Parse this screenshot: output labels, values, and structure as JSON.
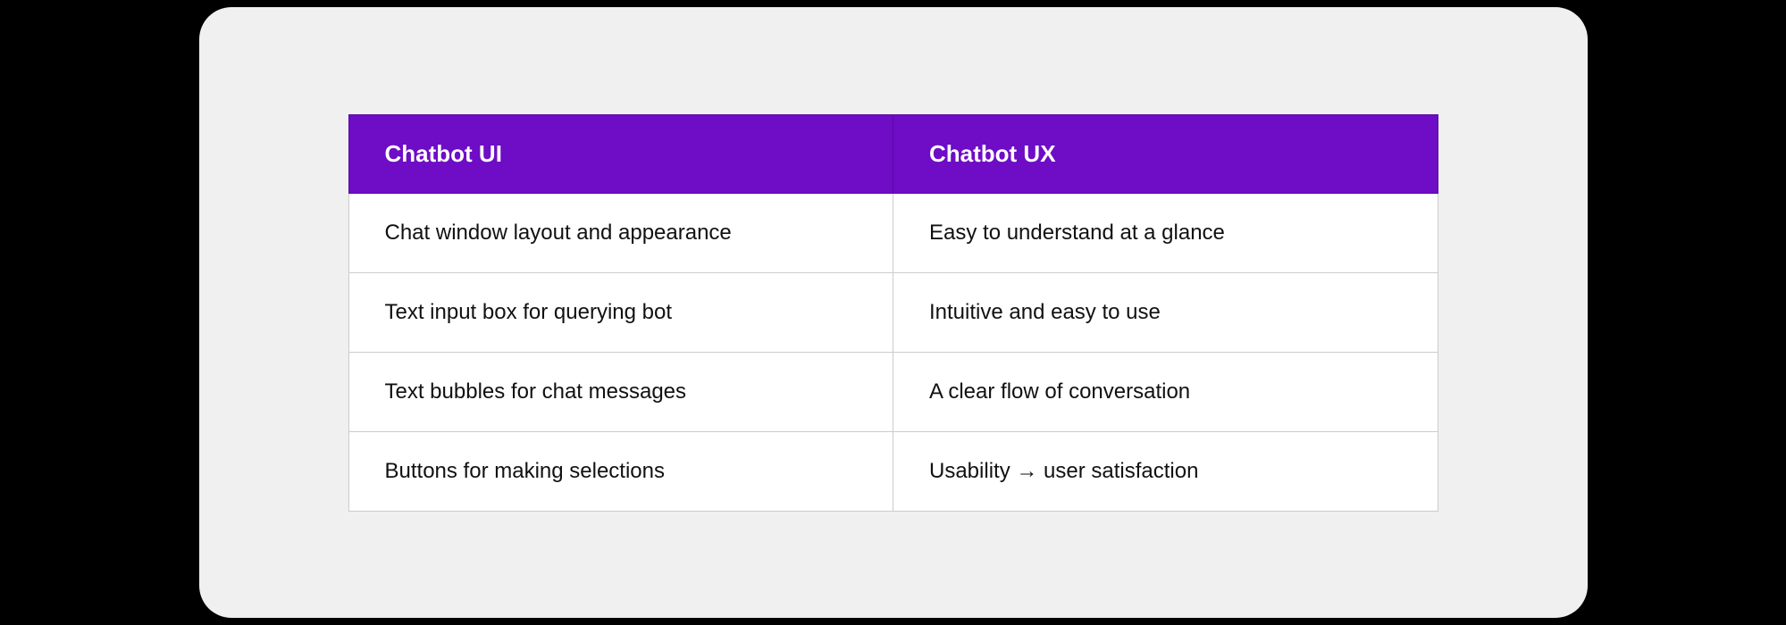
{
  "table": {
    "headers": [
      "Chatbot UI",
      "Chatbot UX"
    ],
    "rows": [
      [
        "Chat window layout and appearance",
        "Easy to understand at a glance"
      ],
      [
        "Text input box for querying bot",
        "Intuitive and easy to use"
      ],
      [
        "Text bubbles for chat messages",
        "A clear flow of conversation"
      ],
      [
        "Buttons for making selections",
        "Usability → user satisfaction"
      ]
    ]
  }
}
